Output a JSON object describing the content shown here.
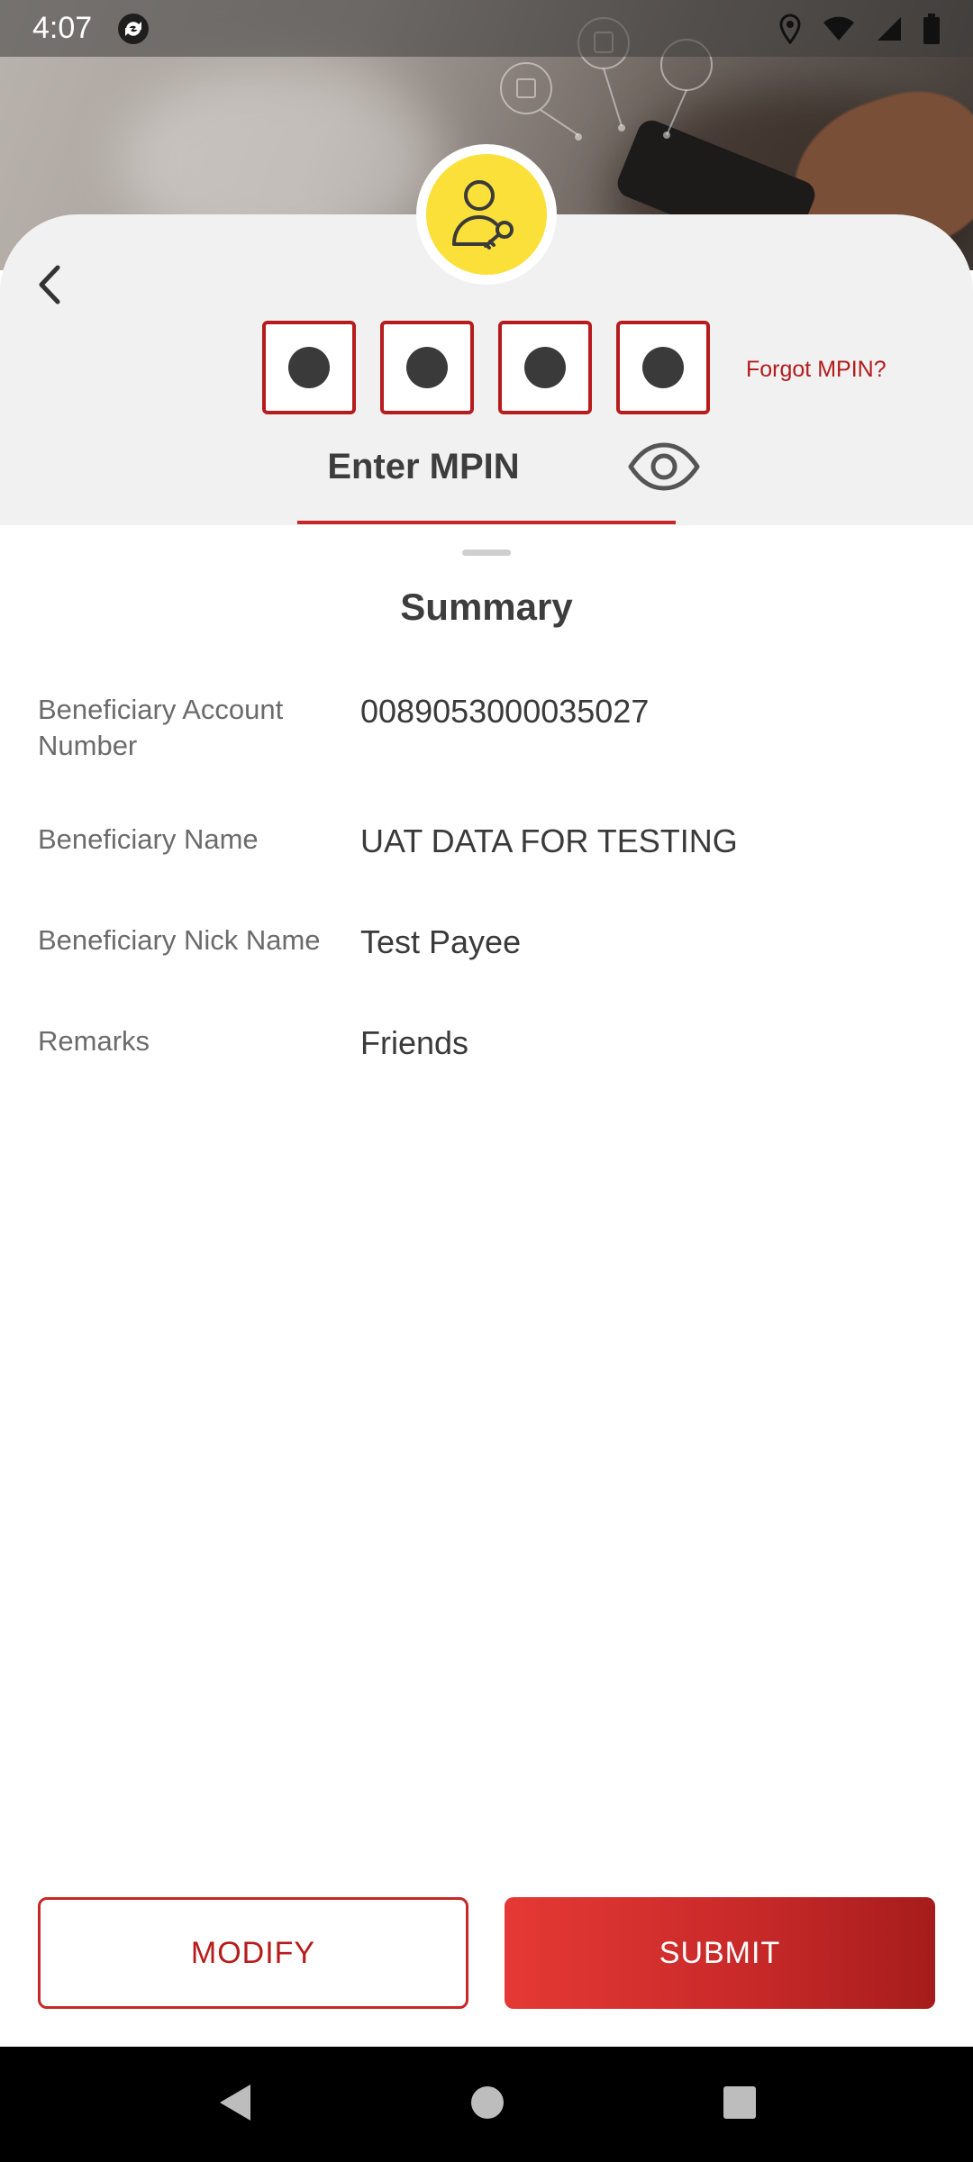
{
  "status_bar": {
    "time": "4:07"
  },
  "mpin": {
    "forgot_label": "Forgot MPIN?",
    "enter_label": "Enter MPIN",
    "digits_filled": 4
  },
  "summary": {
    "title": "Summary",
    "rows": [
      {
        "label": "Beneficiary Account Number",
        "value": "0089053000035027"
      },
      {
        "label": "Beneficiary Name",
        "value": "UAT DATA FOR TESTING"
      },
      {
        "label": "Beneficiary Nick Name",
        "value": "Test Payee"
      },
      {
        "label": "Remarks",
        "value": "Friends"
      }
    ]
  },
  "actions": {
    "modify_label": "MODIFY",
    "submit_label": "SUBMIT"
  },
  "colors": {
    "accent": "#c62828",
    "avatar_bg": "#fbe03a",
    "card_bg": "#f2f1f1"
  },
  "icons": [
    "back-arrow-icon",
    "user-key-icon",
    "eye-icon",
    "location-icon",
    "wifi-icon",
    "signal-icon",
    "battery-icon",
    "sync-icon"
  ]
}
